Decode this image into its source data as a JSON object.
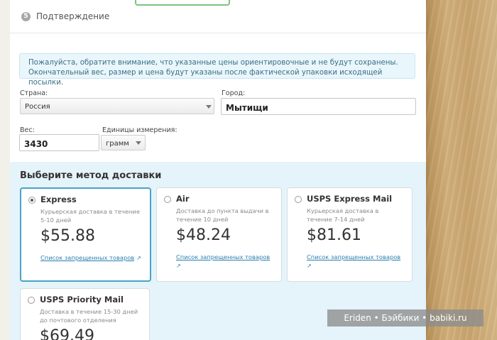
{
  "step": {
    "number": "5",
    "title": "Подтверждение"
  },
  "notice": {
    "line1": "Пожалуйста, обратите внимание, что указанные цены ориентировочные и не будут сохранены.",
    "line2": "Окончательный вес, размер и цена будут указаны после фактической упаковки исходящей посылки."
  },
  "form": {
    "country_label": "Страна:",
    "country_value": "Россия",
    "city_label": "Город:",
    "city_value": "Мытищи",
    "weight_label": "Вес:",
    "weight_value": "3430",
    "units_label": "Единицы измерения:",
    "units_value": "грамм"
  },
  "delivery": {
    "title": "Выберите метод доставки",
    "methods": [
      {
        "name": "Express",
        "desc1": "Курьерская доставка в течение",
        "desc2": "5-10 дней",
        "price": "$55.88",
        "link": "Список запрещенных товаров",
        "selected": true
      },
      {
        "name": "Air",
        "desc1": "Доставка до пункта выдачи в",
        "desc2": "течение 10 дней",
        "price": "$48.24",
        "link": "Список запрещенных товаров",
        "selected": false
      },
      {
        "name": "USPS Express Mail",
        "desc1": "Курьерская доставка в",
        "desc2": "течение 7-14 дней",
        "price": "$81.61",
        "link": "Список запрещенных товаров",
        "selected": false
      },
      {
        "name": "USPS Priority Mail",
        "desc1": "Доставка в течение 15-30 дней",
        "desc2": "до почтового отделения",
        "price": "$69.49",
        "selected": false
      }
    ]
  },
  "watermark": "Eriden • Бэйбики • babiki.ru",
  "colors": {
    "accent": "#49a3c8",
    "section_bg": "#e5f3fa",
    "notice_bg": "#e9f6fb",
    "link": "#2a7fb0"
  }
}
